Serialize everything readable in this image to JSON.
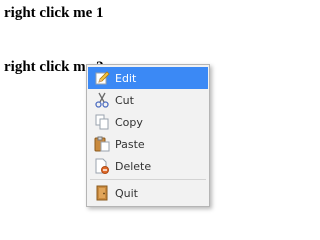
{
  "targets": {
    "first": "right click me 1",
    "second": "right click me 2"
  },
  "context_menu": {
    "items": [
      {
        "label": "Edit",
        "icon": "edit-icon",
        "highlighted": true
      },
      {
        "label": "Cut",
        "icon": "scissors-icon",
        "highlighted": false
      },
      {
        "label": "Copy",
        "icon": "copy-icon",
        "highlighted": false
      },
      {
        "label": "Paste",
        "icon": "paste-icon",
        "highlighted": false
      },
      {
        "label": "Delete",
        "icon": "delete-icon",
        "highlighted": false
      },
      {
        "label": "Quit",
        "icon": "quit-icon",
        "highlighted": false
      }
    ],
    "colors": {
      "highlight": "#3b89f5",
      "background": "#f2f2f2"
    }
  }
}
